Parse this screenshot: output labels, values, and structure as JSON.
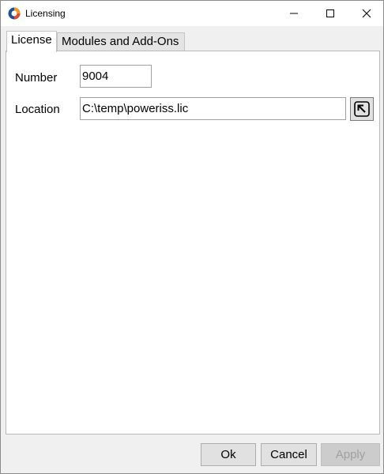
{
  "window": {
    "title": "Licensing",
    "minimize_glyph": "—",
    "maximize_glyph": "☐",
    "close_glyph": "✕"
  },
  "tabs": [
    {
      "label": "License",
      "active": true
    },
    {
      "label": "Modules and Add-Ons",
      "active": false
    }
  ],
  "license": {
    "number_label": "Number",
    "number_value": "9004",
    "location_label": "Location",
    "location_value": "C:\\temp\\poweriss.lic"
  },
  "buttons": {
    "ok": "Ok",
    "cancel": "Cancel",
    "apply": "Apply",
    "apply_enabled": false
  },
  "icons": {
    "app": "app-logo-icon",
    "browse": "browse-arrow-icon"
  }
}
